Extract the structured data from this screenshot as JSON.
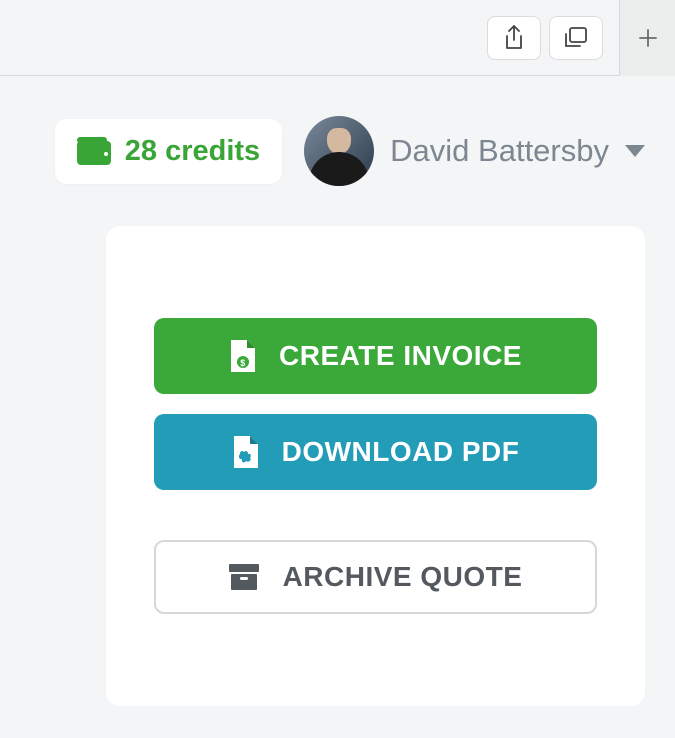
{
  "header": {
    "credits_label": "28 credits",
    "user_name": "David Battersby"
  },
  "actions": {
    "create_invoice": "CREATE INVOICE",
    "download_pdf": "DOWNLOAD PDF",
    "archive_quote": "ARCHIVE QUOTE"
  },
  "colors": {
    "green": "#3ba93a",
    "teal": "#239cb8",
    "text_muted": "#7d8791"
  }
}
